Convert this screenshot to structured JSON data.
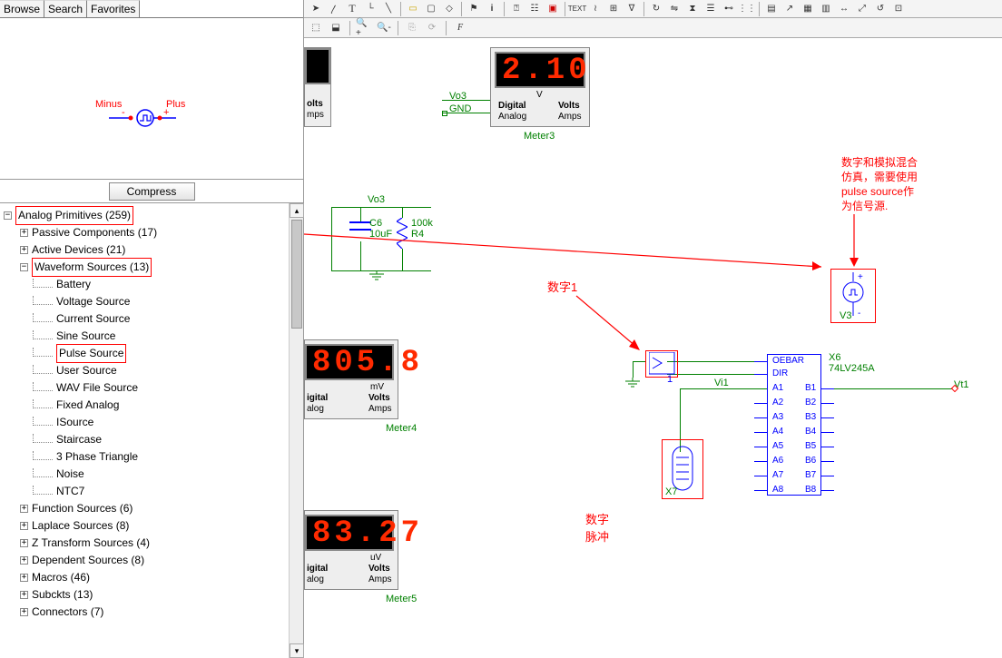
{
  "tabs": {
    "browse": "Browse",
    "search": "Search",
    "favorites": "Favorites"
  },
  "preview": {
    "minus": "Minus",
    "plus": "Plus"
  },
  "compress": "Compress",
  "tree": {
    "root": "Analog Primitives (259)",
    "passive": "Passive Components (17)",
    "active": "Active Devices (21)",
    "waveform": "Waveform Sources (13)",
    "items": [
      "Battery",
      "Voltage Source",
      "Current Source",
      "Sine Source",
      "Pulse Source",
      "User Source",
      "WAV File Source",
      "Fixed Analog",
      "ISource",
      "Staircase",
      "3 Phase Triangle",
      "Noise",
      "NTC7"
    ],
    "func": "Function Sources (6)",
    "laplace": "Laplace Sources (8)",
    "ztrans": "Z Transform Sources (4)",
    "dep": "Dependent Sources (8)",
    "macros": "Macros (46)",
    "subckts": "Subckts (13)",
    "connectors": "Connectors (7)"
  },
  "canvas": {
    "meter": {
      "v": "V",
      "digital": "Digital",
      "analog": "Analog",
      "volts": "Volts",
      "amps": "Amps",
      "igital": "igital",
      "alog": "alog",
      "olts": "olts",
      "mps": "mps",
      "m3": "Meter3",
      "m4": "Meter4",
      "m5": "Meter5",
      "mv": "mV",
      "uv": "uV",
      "val_top": "2.10",
      "val_m4": "805.8",
      "val_m5": "83.27"
    },
    "net": {
      "vo3": "Vo3",
      "gnd": "GND",
      "vi1": "Vi1",
      "vt1": "Vt1"
    },
    "comp": {
      "c6": "C6",
      "c6v": "10uF",
      "r4": "100k",
      "r4n": "R4",
      "v3": "V3",
      "x6": "X6",
      "x6p": "74LV245A",
      "x7": "X7"
    },
    "pins": {
      "oebar": "OEBAR",
      "dir": "DIR",
      "a1": "A1",
      "a2": "A2",
      "a3": "A3",
      "a4": "A4",
      "a5": "A5",
      "a6": "A6",
      "a7": "A7",
      "a8": "A8",
      "b1": "B1",
      "b2": "B2",
      "b3": "B3",
      "b4": "B4",
      "b5": "B5",
      "b6": "B6",
      "b7": "B7",
      "b8": "B8"
    },
    "ann": {
      "one": "1",
      "shuzi1": "数字1",
      "shuzi_maichong": "数字\n脉冲",
      "note1": "数字和模拟混合",
      "note2": "仿真，需要使用",
      "note3": "pulse source作",
      "note4": "为信号源."
    }
  }
}
